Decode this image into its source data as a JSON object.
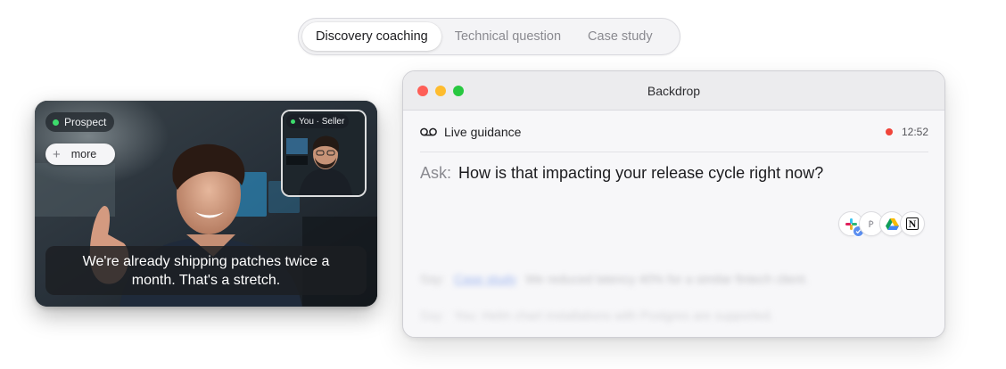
{
  "tabs": [
    {
      "label": "Discovery coaching",
      "active": true
    },
    {
      "label": "Technical question",
      "active": false
    },
    {
      "label": "Case study",
      "active": false
    }
  ],
  "video": {
    "prospect_label": "Prospect",
    "more_label": "more",
    "self_label": "You · Seller",
    "caption": "We're already shipping patches twice a month. That's a stretch."
  },
  "window": {
    "title": "Backdrop",
    "guidance_label": "Live guidance",
    "timer": "12:52",
    "ask_label": "Ask:",
    "ask_text": "How is that impacting your release cycle right now?",
    "source_icons": [
      "slack-icon",
      "pendo-icon",
      "google-drive-icon",
      "notion-icon"
    ],
    "blurred_rows": [
      {
        "label": "Say:",
        "link": "Case study",
        "text": "We reduced latency 40% for a similar fintech client."
      },
      {
        "label": "Say:",
        "link": "",
        "text": "You: Helm chart installations with Postgres are supported."
      }
    ]
  },
  "colors": {
    "accent_blue": "#5b8ef0",
    "recording_red": "#f0443a",
    "online_green": "#3ddc6c"
  }
}
